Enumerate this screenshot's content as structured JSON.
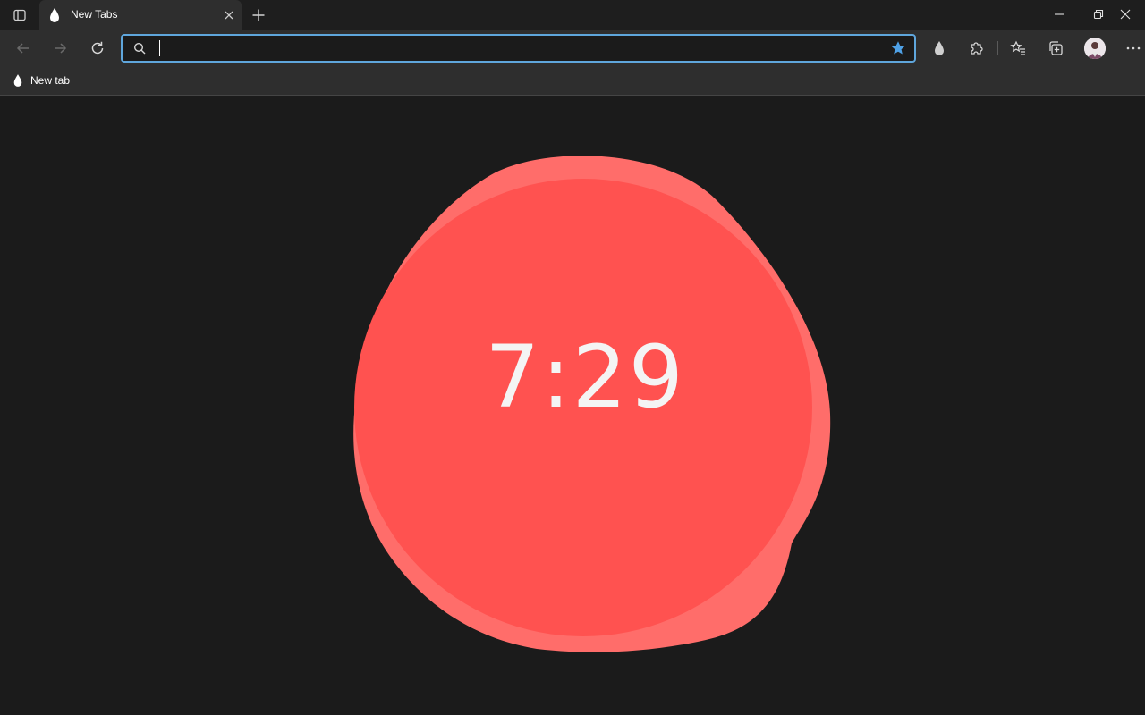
{
  "window": {
    "tab_title": "New Tabs"
  },
  "omnibox": {
    "value": "",
    "placeholder": ""
  },
  "favorites": {
    "items": [
      {
        "label": "New tab",
        "icon": "drop-icon"
      }
    ]
  },
  "clock": {
    "time": "7:29"
  },
  "icons": {
    "tab_actions": "tab-actions-icon",
    "favicon": "drop-icon",
    "close": "close-icon",
    "new_tab": "plus-icon",
    "minimize": "minimize-icon",
    "restore": "restore-icon",
    "close_window": "close-icon",
    "back": "back-arrow-icon",
    "forward": "forward-arrow-icon",
    "refresh": "refresh-icon",
    "search": "search-icon",
    "star": "star-icon",
    "extension_drop": "drop-icon",
    "extensions": "puzzle-icon",
    "favorites": "favorites-icon",
    "collections": "collections-icon",
    "profile": "avatar",
    "menu": "more-icon"
  },
  "colors": {
    "background": "#1b1b1b",
    "chrome": "#2e2e2e",
    "accent_focus": "#5fa6dc",
    "blob_outer": "#ff6d6a",
    "blob_inner": "#ff5250",
    "clock_text": "#f4f4f4"
  }
}
